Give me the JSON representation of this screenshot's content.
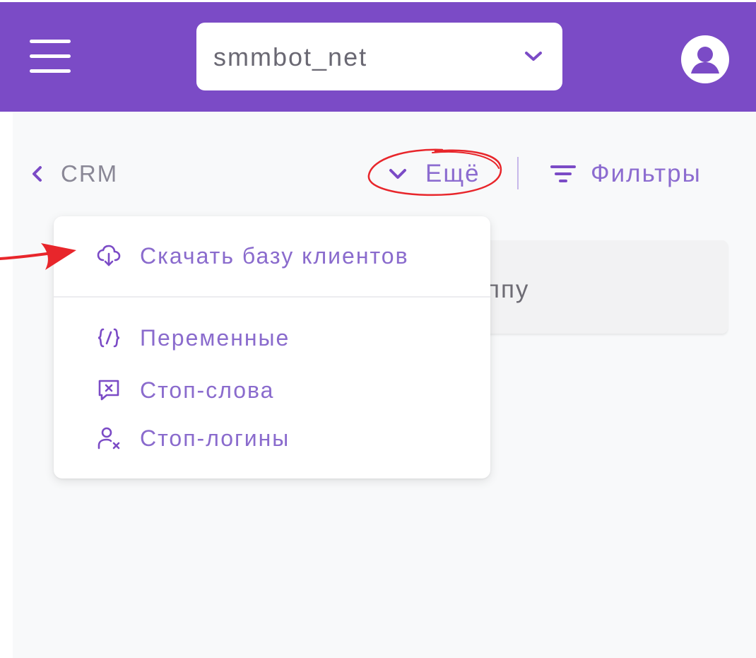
{
  "header": {
    "account_select": {
      "value": "smmbot_net"
    }
  },
  "toolbar": {
    "back_label": "CRM",
    "more_label": "Ещё",
    "filters_label": "Фильтры"
  },
  "background_card": {
    "visible_text": "ппу"
  },
  "dropdown": {
    "items": [
      {
        "label": "Скачать базу клиентов",
        "icon": "cloud-download-icon"
      },
      {
        "label": "Переменные",
        "icon": "variable-braces-icon"
      },
      {
        "label": "Стоп-слова",
        "icon": "message-x-icon"
      },
      {
        "label": "Стоп-логины",
        "icon": "user-x-icon"
      }
    ]
  },
  "colors": {
    "header_bg": "#7b4bc6",
    "accent": "#8c6cd0",
    "annotation": "#e8262b"
  }
}
